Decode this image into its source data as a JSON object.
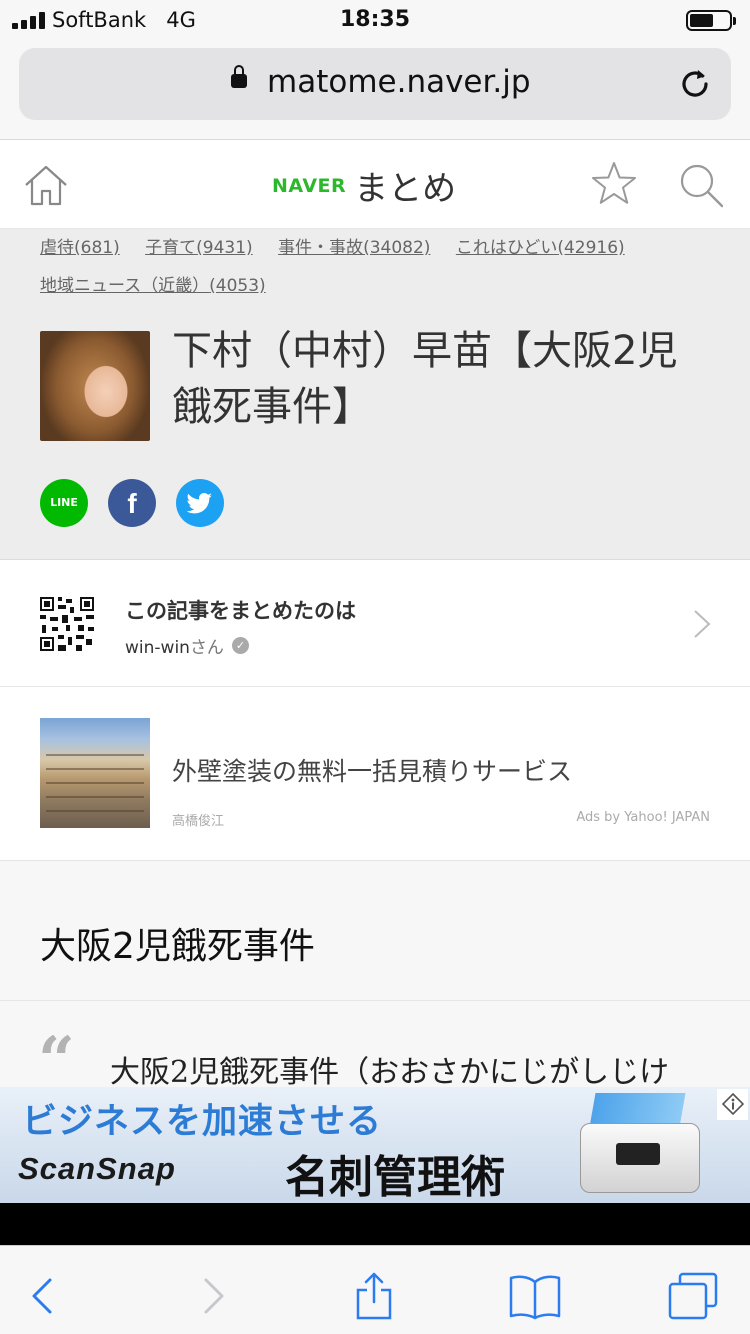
{
  "status_bar": {
    "carrier": "SoftBank",
    "network": "4G",
    "time": "18:35",
    "battery_level": 0.6
  },
  "browser": {
    "url": "matome.naver.jp"
  },
  "site_header": {
    "logo_brand": "NAVER",
    "logo_text": "まとめ"
  },
  "tags": [
    {
      "label": "虐待",
      "count": "(681)"
    },
    {
      "label": "子育て",
      "count": "(9431)"
    },
    {
      "label": "事件・事故",
      "count": "(34082)"
    },
    {
      "label": "これはひどい",
      "count": "(42916)"
    },
    {
      "label": "地域ニュース（近畿）",
      "count": "(4053)"
    }
  ],
  "article": {
    "title": "下村（中村）早苗【大阪2児餓死事件】"
  },
  "share": {
    "line_label": "LINE",
    "facebook_label": "f"
  },
  "author": {
    "heading": "この記事をまとめたのは",
    "name": "win-win",
    "suffix": "さん"
  },
  "ad": {
    "title": "外壁塗装の無料一括見積りサービス",
    "advertiser": "高橋俊江",
    "provider": "Ads by Yahoo! JAPAN"
  },
  "section": {
    "heading": "大阪2児餓死事件"
  },
  "quote": {
    "mark": "“",
    "text": "大阪2児餓死事件（おおさかにじがしじけ"
  },
  "banner": {
    "tagline": "ビジネスを加速させる",
    "brand": "ScanSnap",
    "headline": "名刺管理術"
  }
}
